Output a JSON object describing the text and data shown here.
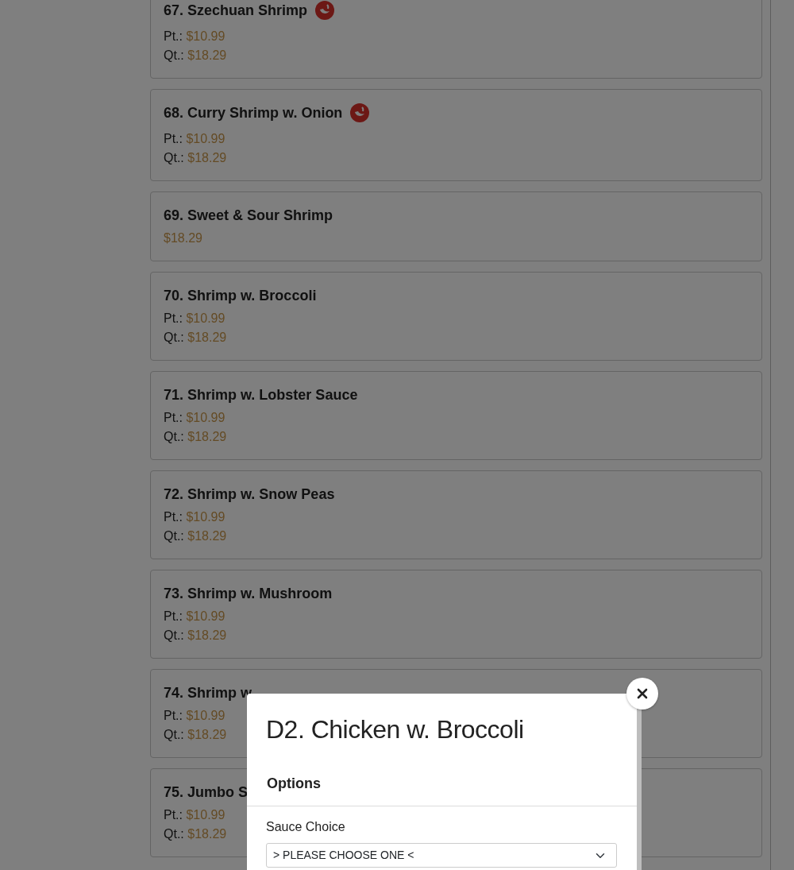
{
  "menu_items": [
    {
      "title": "67. Szechuan Shrimp",
      "hot": true,
      "prices": [
        {
          "label": "Pt.:",
          "price": "$10.99"
        },
        {
          "label": "Qt.:",
          "price": "$18.29"
        }
      ]
    },
    {
      "title": "68. Curry Shrimp w. Onion",
      "hot": true,
      "prices": [
        {
          "label": "Pt.:",
          "price": "$10.99"
        },
        {
          "label": "Qt.:",
          "price": "$18.29"
        }
      ]
    },
    {
      "title": "69. Sweet & Sour Shrimp",
      "hot": false,
      "prices": [
        {
          "price": "$18.29"
        }
      ]
    },
    {
      "title": "70. Shrimp w. Broccoli",
      "hot": false,
      "prices": [
        {
          "label": "Pt.:",
          "price": "$10.99"
        },
        {
          "label": "Qt.:",
          "price": "$18.29"
        }
      ]
    },
    {
      "title": "71. Shrimp w. Lobster Sauce",
      "hot": false,
      "prices": [
        {
          "label": "Pt.:",
          "price": "$10.99"
        },
        {
          "label": "Qt.:",
          "price": "$18.29"
        }
      ]
    },
    {
      "title": "72. Shrimp w. Snow Peas",
      "hot": false,
      "prices": [
        {
          "label": "Pt.:",
          "price": "$10.99"
        },
        {
          "label": "Qt.:",
          "price": "$18.29"
        }
      ]
    },
    {
      "title": "73. Shrimp w. Mushroom",
      "hot": false,
      "prices": [
        {
          "label": "Pt.:",
          "price": "$10.99"
        },
        {
          "label": "Qt.:",
          "price": "$18.29"
        }
      ]
    },
    {
      "title": "74. Shrimp w",
      "hot": false,
      "prices": [
        {
          "label": "Pt.:",
          "price": "$10.99"
        },
        {
          "label": "Qt.:",
          "price": "$18.29"
        }
      ]
    },
    {
      "title": "75. Jumbo S",
      "hot": false,
      "prices": [
        {
          "label": "Pt.:",
          "price": "$10.99"
        },
        {
          "label": "Qt.:",
          "price": "$18.29"
        }
      ]
    }
  ],
  "modal": {
    "title": "D2. Chicken w. Broccoli",
    "section": "Options",
    "field_label": "Sauce Choice",
    "select_value": "> PLEASE CHOOSE ONE <"
  }
}
